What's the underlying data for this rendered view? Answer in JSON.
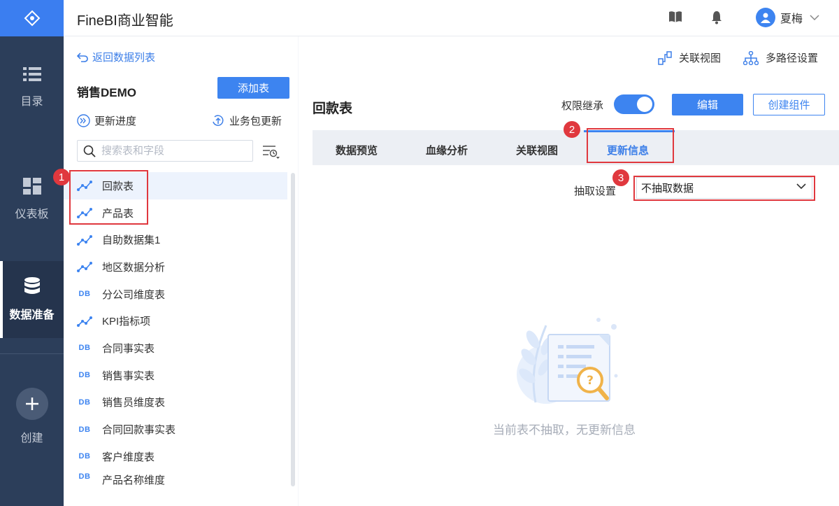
{
  "app": {
    "title": "FineBI商业智能"
  },
  "nav": {
    "items": [
      {
        "label": "目录",
        "icon": "list-icon"
      },
      {
        "label": "仪表板",
        "icon": "dashboard-icon"
      },
      {
        "label": "数据准备",
        "icon": "database-icon"
      },
      {
        "label": "创建",
        "icon": "plus-icon"
      }
    ],
    "active": "数据准备"
  },
  "header": {
    "user_name": "夏梅"
  },
  "sidebar": {
    "back_label": "返回数据列表",
    "package_name": "销售DEMO",
    "add_table_label": "添加表",
    "update_progress_label": "更新进度",
    "package_update_label": "业务包更新",
    "search_placeholder": "搜索表和字段",
    "tables": [
      {
        "name": "回款表",
        "type": "self-service"
      },
      {
        "name": "产品表",
        "type": "self-service"
      },
      {
        "name": "自助数据集1",
        "type": "self-service"
      },
      {
        "name": "地区数据分析",
        "type": "self-service"
      },
      {
        "name": "分公司维度表",
        "type": "db"
      },
      {
        "name": "KPI指标项",
        "type": "self-service"
      },
      {
        "name": "合同事实表",
        "type": "db"
      },
      {
        "name": "销售事实表",
        "type": "db"
      },
      {
        "name": "销售员维度表",
        "type": "db"
      },
      {
        "name": "合同回款事实表",
        "type": "db"
      },
      {
        "name": "客户维度表",
        "type": "db"
      },
      {
        "name": "产品名称维度",
        "type": "db"
      }
    ],
    "db_icon_text": "DB"
  },
  "toolbar": {
    "relation_view_label": "关联视图",
    "multipath_label": "多路径设置"
  },
  "main": {
    "table_title": "回款表",
    "permission_label": "权限继承",
    "permission_on": true,
    "edit_label": "编辑",
    "create_component_label": "创建组件",
    "tabs": [
      {
        "label": "数据预览"
      },
      {
        "label": "血缘分析"
      },
      {
        "label": "关联视图"
      },
      {
        "label": "更新信息"
      }
    ],
    "active_tab": "更新信息",
    "extract_label": "抽取设置",
    "extract_value": "不抽取数据",
    "empty_message": "当前表不抽取，无更新信息"
  },
  "annotations": {
    "badges": [
      "1",
      "2",
      "3"
    ]
  },
  "colors": {
    "accent": "#3d84f0",
    "nav_bg": "#2c3e5a",
    "annotation": "#e0383e"
  }
}
